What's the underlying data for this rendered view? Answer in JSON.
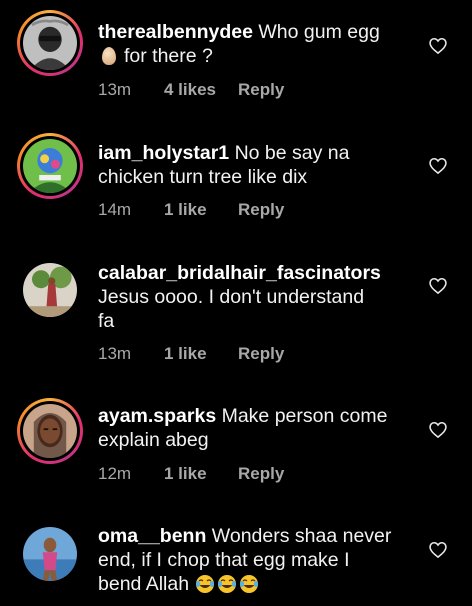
{
  "comments": [
    {
      "username": "therealbennydee",
      "text_line1": "Who gum egg",
      "text_line2": "for there ?",
      "time": "13m",
      "likes": "4 likes",
      "reply": "Reply"
    },
    {
      "username": "iam_holystar1",
      "text_line1": "No be say na",
      "text_line2": "chicken turn tree like dix",
      "time": "14m",
      "likes": "1 like",
      "reply": "Reply"
    },
    {
      "username": "calabar_bridalhair_fascinators",
      "text_line1": "Jesus oooo. I don't understand",
      "text_line2": "fa",
      "time": "13m",
      "likes": "1 like",
      "reply": "Reply"
    },
    {
      "username": "ayam.sparks",
      "text_line1": "Make person come",
      "text_line2": "explain abeg",
      "time": "12m",
      "likes": "1 like",
      "reply": "Reply"
    },
    {
      "username": "oma__benn",
      "text_line1": "Wonders shaa never",
      "text_line2": "end, if I chop that egg make I",
      "text_line3": "bend Allah",
      "time": "",
      "likes": "",
      "reply": ""
    }
  ],
  "icons": {
    "like": "heart-outline-icon",
    "egg": "egg-emoji",
    "laugh": "face-with-tears-of-joy-emoji"
  },
  "colors": {
    "background": "#000000",
    "text": "#f2f2f2",
    "meta": "#a8a8a8",
    "story_ring_start": "#f7b33b",
    "story_ring_end": "#c13584"
  }
}
